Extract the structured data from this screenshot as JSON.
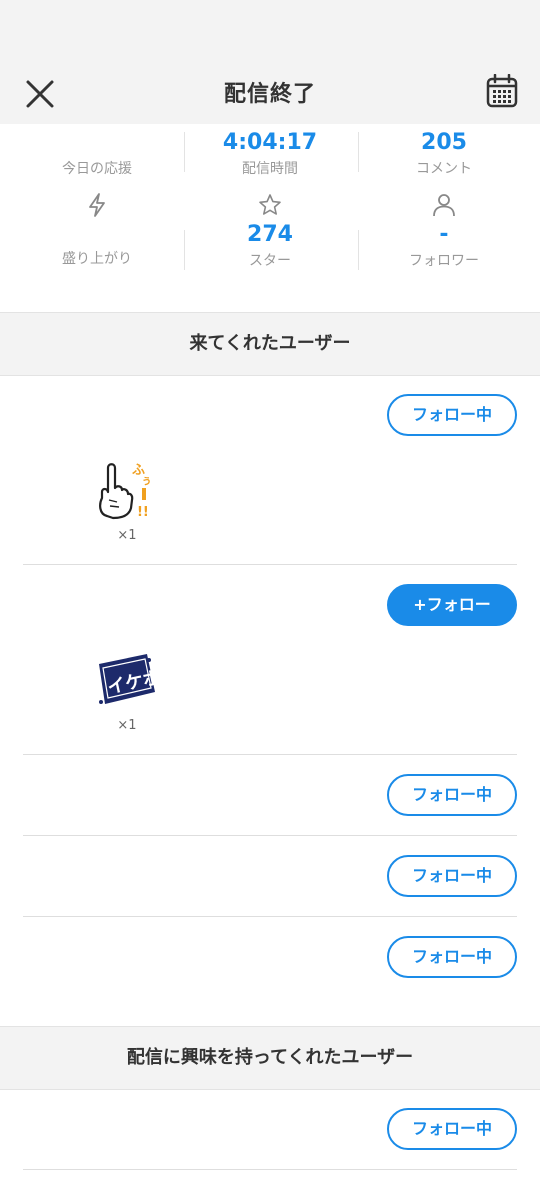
{
  "header": {
    "title": "配信終了"
  },
  "stats": [
    {
      "value": "",
      "label": "今日の応援",
      "icon": "none"
    },
    {
      "value": "4:04:17",
      "label": "配信時間",
      "icon": "none"
    },
    {
      "value": "205",
      "label": "コメント",
      "icon": "none"
    },
    {
      "value": "",
      "label": "盛り上がり",
      "icon": "lightning-icon"
    },
    {
      "value": "274",
      "label": "スター",
      "icon": "star-icon"
    },
    {
      "value": "-",
      "label": "フォロワー",
      "icon": "person-icon"
    }
  ],
  "sections": {
    "visitors_title": "来てくれたユーザー",
    "interested_title": "配信に興味を持ってくれたユーザー"
  },
  "visitors": [
    {
      "button": "フォロー中",
      "state": "following",
      "stamp": "finger-point-stamp",
      "stamp_text": "ふぅー!!",
      "count": "×1"
    },
    {
      "button": "+フォロー",
      "state": "not-following",
      "stamp": "ikebo-stamp",
      "stamp_text": "イケボ",
      "count": "×1"
    },
    {
      "button": "フォロー中",
      "state": "following"
    },
    {
      "button": "フォロー中",
      "state": "following"
    },
    {
      "button": "フォロー中",
      "state": "following"
    }
  ],
  "interested": [
    {
      "button": "フォロー中",
      "state": "following"
    }
  ],
  "colors": {
    "accent": "#1a8be8",
    "header_bg": "#f3f3f3",
    "stamp_orange": "#f0a020",
    "stamp_navy": "#1d2a6b"
  }
}
